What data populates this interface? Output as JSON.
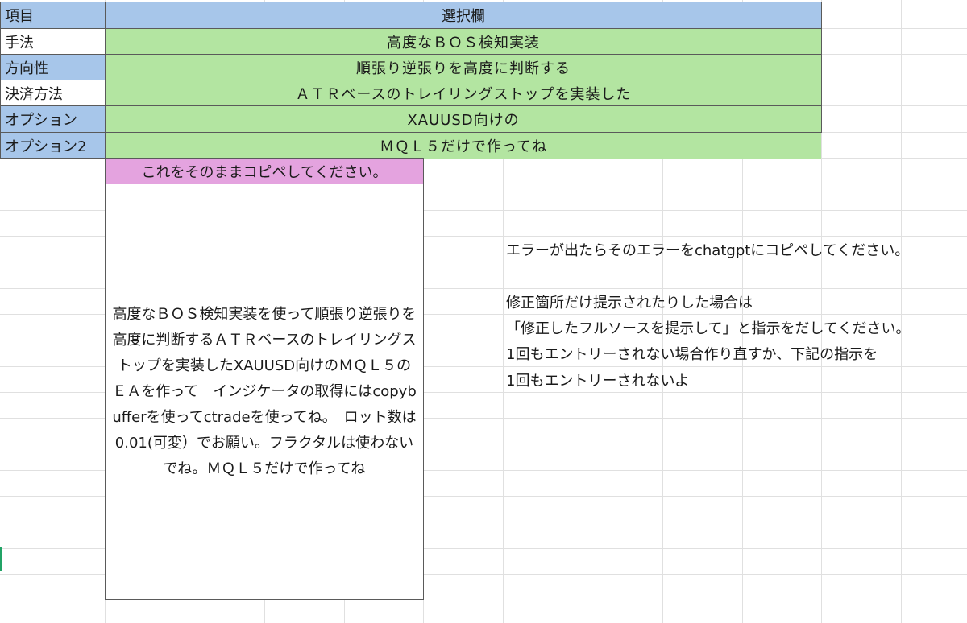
{
  "table": {
    "header": {
      "item": "項目",
      "selection": "選択欄"
    },
    "rows": [
      {
        "label": "手法",
        "value": "高度なＢＯＳ検知実装"
      },
      {
        "label": "方向性",
        "value": "順張り逆張りを高度に判断する"
      },
      {
        "label": "決済方法",
        "value": "ＡＴＲベースのトレイリングストップを実装した"
      },
      {
        "label": "オプション",
        "value": "XAUUSD向けの"
      },
      {
        "label": "オプション2",
        "value": "ＭＱＬ５だけで作ってね"
      }
    ]
  },
  "instruction": {
    "title": "これをそのままコピペしてください。",
    "prompt": "高度なＢＯＳ検知実装を使って順張り逆張りを高度に判断するＡＴＲベースのトレイリングストップを実装したXAUUSD向けのＭＱＬ５のＥＡを作って　インジケータの取得にはcopybufferを使ってctradeを使ってね。　ロット数は0.01(可変）でお願い。フラクタルは使わないでね。ＭＱＬ５だけで作ってね"
  },
  "notes": {
    "line1": "エラーが出たらそのエラーをchatgptにコピペしてください。",
    "line2": "修正箇所だけ提示されたりした場合は",
    "line3": "「修正したフルソースを提示して」と指示をだしてください。",
    "line4": "1回もエントリーされない場合作り直すか、下記の指示を",
    "line5": "1回もエントリーされないよ"
  },
  "colors": {
    "label_blue": "#a7c6ea",
    "value_green": "#b3e5a1",
    "title_pink": "#e4a3df",
    "gridline": "#e0e0e0"
  }
}
